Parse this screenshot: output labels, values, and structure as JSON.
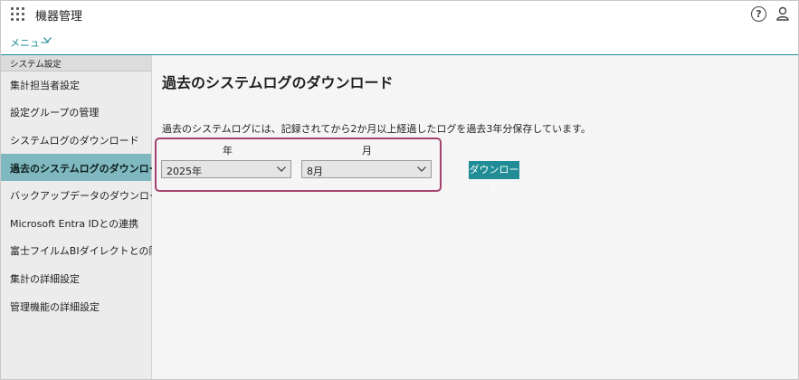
{
  "header": {
    "app_title": "機器管理"
  },
  "menubar": {
    "menu_label": "メニュー"
  },
  "sidebar": {
    "section_title": "システム設定",
    "items": [
      {
        "label": "集計担当者設定"
      },
      {
        "label": "設定グループの管理"
      },
      {
        "label": "システムログのダウンロード"
      },
      {
        "label": "過去のシステムログのダウンロード",
        "active": true
      },
      {
        "label": "バックアップデータのダウンロード"
      },
      {
        "label": "Microsoft Entra IDとの連携"
      },
      {
        "label": "富士フイルムBIダイレクトとの同期"
      },
      {
        "label": "集計の詳細設定"
      },
      {
        "label": "管理機能の詳細設定"
      }
    ]
  },
  "main": {
    "title": "過去のシステムログのダウンロード",
    "description": "過去のシステムログには、記録されてから2か月以上経過したログを過去3年分保存しています。",
    "year_label": "年",
    "month_label": "月",
    "year_value": "2025年",
    "month_value": "8月",
    "download_label": "ダウンロード"
  },
  "colors": {
    "accent": "#1f8c96",
    "active_item": "#7fb8be",
    "highlight": "#a2426d"
  }
}
